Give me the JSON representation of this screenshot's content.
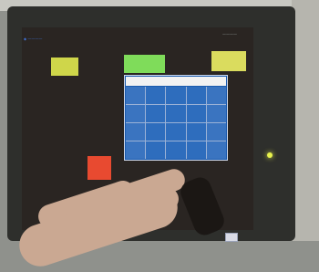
{
  "topbar": {
    "left_label": "◆ ————",
    "right_label": "————"
  },
  "buttons": {
    "left_yellow": "",
    "center_green": "",
    "right_yellow": ""
  },
  "keypad": {
    "display_value": "",
    "keys": [
      "",
      "",
      "",
      "",
      "",
      "",
      "",
      "",
      "",
      "",
      "",
      "",
      "",
      "",
      "",
      "",
      "",
      "",
      "",
      ""
    ]
  },
  "footer": {
    "text": ""
  },
  "colors": {
    "screen_background": "#2a2522",
    "keypad_blue": "#1b5bae",
    "button_yellow": "#dadc5e",
    "button_green": "#7fdc5a",
    "alarm_red": "#e84a30",
    "indicator_led": "#e8f24d"
  },
  "icons": {
    "status_led": "indicator-led-icon"
  }
}
